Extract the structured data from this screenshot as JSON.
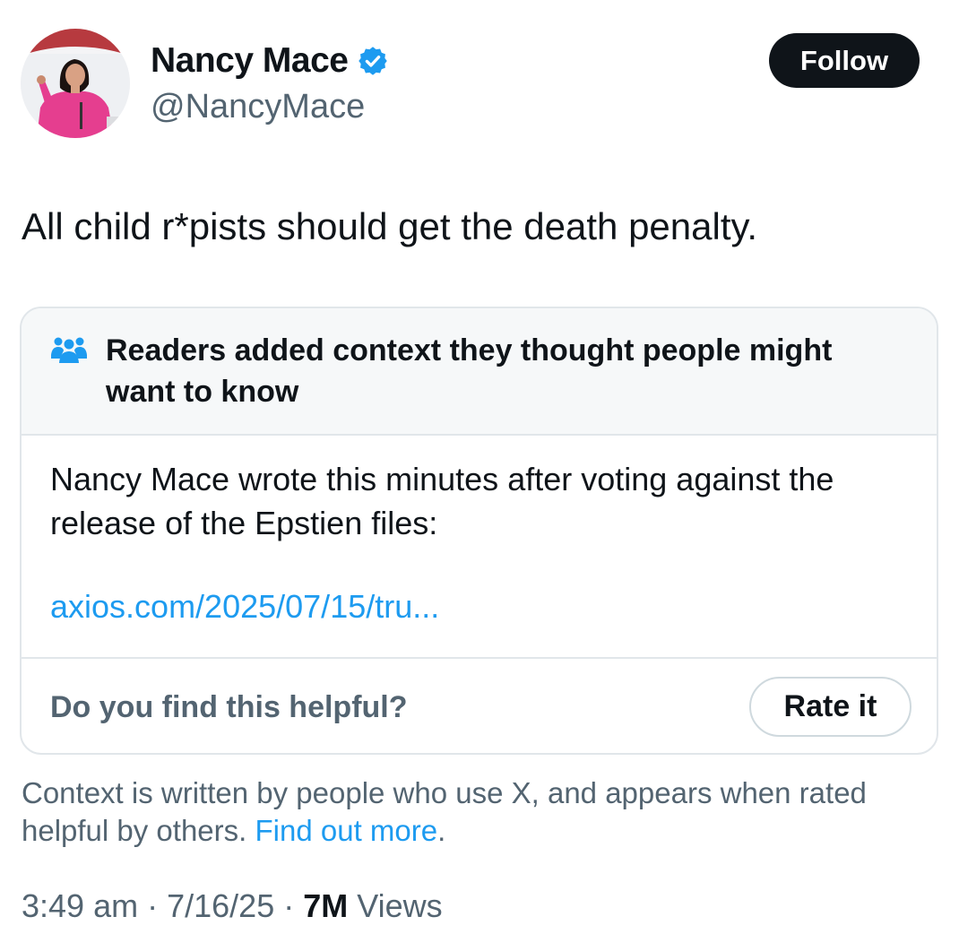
{
  "author": {
    "name": "Nancy Mace",
    "handle": "@NancyMace",
    "verified_icon": "verified-badge-icon",
    "verified_color": "#1d9bf0"
  },
  "follow_label": "Follow",
  "tweet_text": "All child r*pists should get the death penalty.",
  "community_note": {
    "icon": "people-icon",
    "header": "Readers added context they thought people might want to know",
    "body": "Nancy Mace wrote this minutes after voting against the release of the Epstien files:",
    "link": "axios.com/2025/07/15/tru...",
    "helpful_question": "Do you find this helpful?",
    "rate_label": "Rate it"
  },
  "context_footer": {
    "text": "Context is written by people who use X, and appears when rated helpful by others.",
    "link": "Find out more",
    "link_suffix": "."
  },
  "meta": {
    "time": "3:49 am",
    "separator": "·",
    "date": "7/16/25",
    "views_count": "7M",
    "views_label": "Views"
  },
  "colors": {
    "text": "#0f1419",
    "secondary": "#536471",
    "link": "#1d9bf0",
    "border": "#e1e6ea",
    "note_header_bg": "#f6f8f9"
  }
}
